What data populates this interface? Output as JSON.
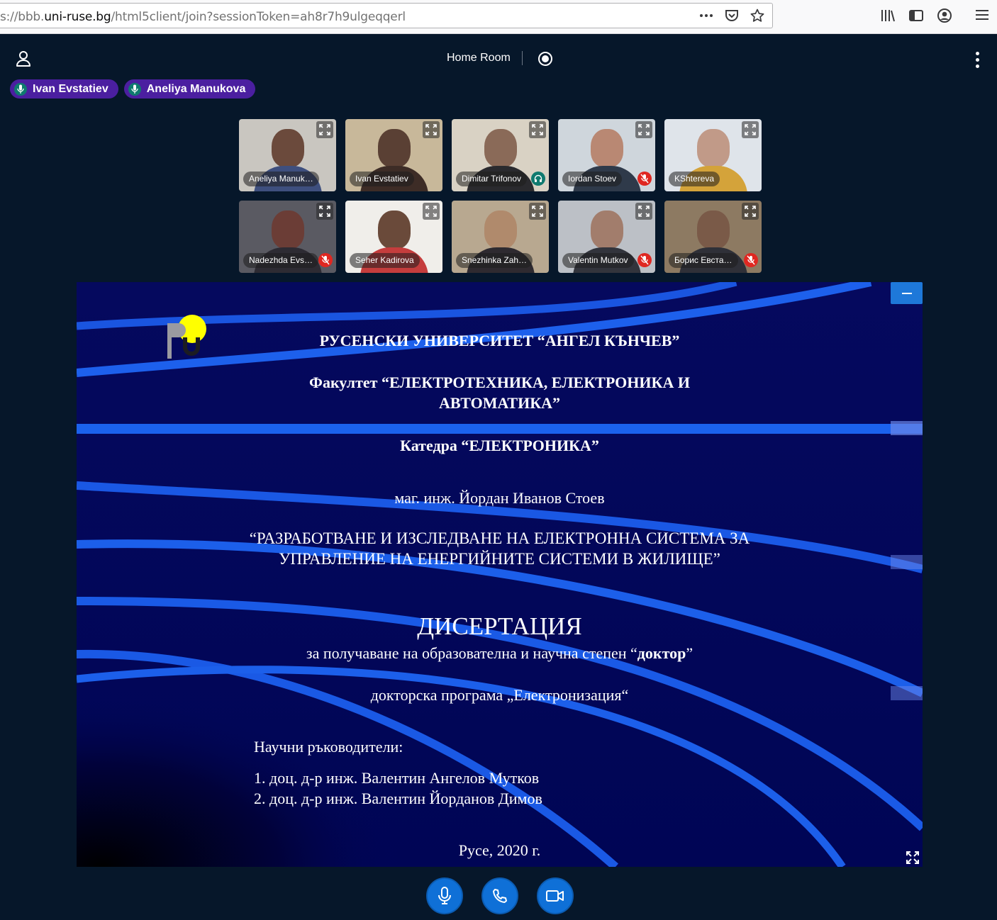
{
  "browser": {
    "url_prefix": "s://bbb.",
    "url_host": "uni-ruse.bg",
    "url_path": "/html5client/join?sessionToken=ah8r7h9ulgeqqerl",
    "more_icon": "ellipsis-icon",
    "pocket_icon": "pocket-icon",
    "bookmark_icon": "star-icon"
  },
  "header": {
    "room_title": "Home Room"
  },
  "talking": [
    {
      "name": "Ivan Evstatiev"
    },
    {
      "name": "Aneliya Manukova"
    }
  ],
  "videos": [
    {
      "name": "Aneliya Manuk…",
      "status": "none",
      "bg": "#c9c6c0",
      "head": "#6b4a3c",
      "body": "#3e4f7e"
    },
    {
      "name": "Ivan Evstatiev",
      "status": "none",
      "bg": "#c8b89a",
      "head": "#5a4034",
      "body": "#3d2c26"
    },
    {
      "name": "Dimitar Trifonov",
      "status": "listen",
      "bg": "#d9d2c4",
      "head": "#8a6a58",
      "body": "#2a2a2e"
    },
    {
      "name": "Iordan Stoev",
      "status": "muted",
      "bg": "#cfd6dc",
      "head": "#b98873",
      "body": "#2f3a4a"
    },
    {
      "name": "KShtereva",
      "status": "none",
      "bg": "#dfe4ea",
      "head": "#c19a88",
      "body": "#d4a33a"
    },
    {
      "name": "Nadezhda Evs…",
      "status": "muted",
      "bg": "#5a5a62",
      "head": "#6b3d36",
      "body": "#2d2b33"
    },
    {
      "name": "Seher Kadirova",
      "status": "none",
      "bg": "#f0eeea",
      "head": "#6a4a3a",
      "body": "#c53d3d"
    },
    {
      "name": "Snezhinka Zah…",
      "status": "none",
      "bg": "#b8a890",
      "head": "#b08a6c",
      "body": "#2e2a30"
    },
    {
      "name": "Valentin Mutkov",
      "status": "muted",
      "bg": "#bcc0c6",
      "head": "#a27d6c",
      "body": "#32343c"
    },
    {
      "name": "Борис Евста…",
      "status": "muted",
      "bg": "#8d7a62",
      "head": "#7a5a48",
      "body": "#2f3038"
    }
  ],
  "slide": {
    "university": "РУСЕНСКИ УНИВЕРСИТЕТ “АНГЕЛ КЪНЧЕВ”",
    "faculty_line1": "Факултет “ЕЛЕКТРОТЕХНИКА, ЕЛЕКТРОНИКА И",
    "faculty_line2": "АВТОМАТИКА”",
    "department": "Катедра “ЕЛЕКТРОНИКА”",
    "author": "маг. инж. Йордан Иванов Стоев",
    "topic_line1": "“РАЗРАБОТВАНЕ И ИЗСЛЕДВАНЕ НА ЕЛЕКТРОННА СИСТЕМА ЗА",
    "topic_line2": "УПРАВЛЕНИЕ НА ЕНЕРГИЙНИТЕ СИСТЕМИ В ЖИЛИЩЕ”",
    "doc_type": "ДИСЕРТАЦИЯ",
    "degree_prefix": "за получаване на образователна и научна степен  “",
    "degree_bold": "доктор",
    "degree_suffix": "”",
    "program": "докторска програма „Електронизация“",
    "supervisors_label": "Научни ръководители:",
    "supervisor1": "1. доц. д-р инж. Валентин Ангелов Мутков",
    "supervisor2": "2. доц. д-р инж. Валентин Йорданов Димов",
    "place_date": "Русе, 2020 г."
  },
  "colors": {
    "app_bg": "#06172a",
    "talking_bg": "#4b1fa0",
    "accent_blue": "#0f70d7",
    "muted_red": "#df2721",
    "slide_bg": "#02065a"
  }
}
